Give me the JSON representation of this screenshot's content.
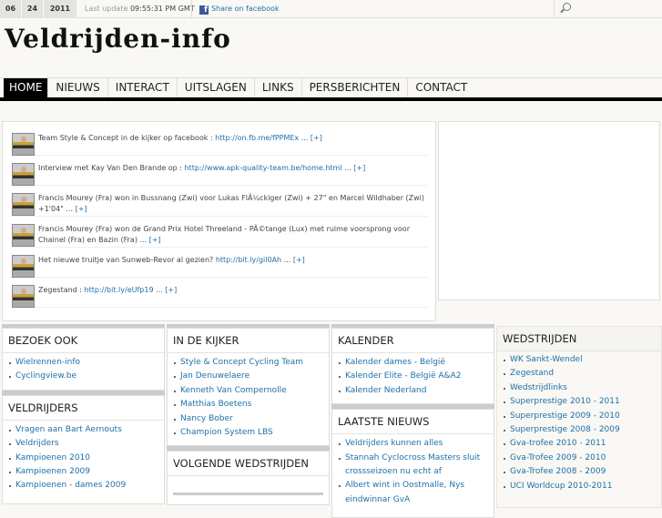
{
  "topbar": {
    "date": {
      "month": "06",
      "day": "24",
      "year": "2011"
    },
    "last_update_label": "Last update",
    "last_update_time": "09:55:31 PM GMT",
    "facebook": "Share on facebook"
  },
  "site_title": "Veldrijden-info",
  "nav": [
    "HOME",
    "NIEUWS",
    "INTERACT",
    "UITSLAGEN",
    "LINKS",
    "PERSBERICHTEN",
    "CONTACT"
  ],
  "feed": [
    {
      "text": "Team Style & Concept in de kijker op facebook :",
      "link": "http://on.fb.me/fPPMEx",
      "more": "[+]"
    },
    {
      "text": "Interview met Kay Van Den Brande op :",
      "link": "http://www.apk-quality-team.be/home.html",
      "more": "[+]"
    },
    {
      "text": "Francis Mourey (Fra) won in Bussnang (Zwi) voor Lukas FlÃ¼ckiger (Zwi) + 27\" en Marcel Wildhaber (Zwi) +1'04\"",
      "link": "",
      "more": "[+]"
    },
    {
      "text": "Francis Mourey (Fra) won de Grand Prix Hotel Threeland - PÃ©tange (Lux) met ruime voorsprong voor Chainel (Fra) en Bazin (Fra)",
      "link": "",
      "more": "[+]"
    },
    {
      "text": "Het nieuwe truitje van Sunweb-Revor al gezien?",
      "link": "http://bit.ly/gil0Ah",
      "more": "[+]"
    },
    {
      "text": "Zegestand :",
      "link": "http://bit.ly/eUfp19",
      "more": "[+]"
    }
  ],
  "bezoek": {
    "title": "BEZOEK OOK",
    "items": [
      "Wielrennen-info",
      "Cyclingview.be"
    ]
  },
  "veldrijders": {
    "title": "VELDRIJDERS",
    "items": [
      "Vragen aan Bart Aernouts",
      "Veldrijders",
      "Kampioenen 2010",
      "Kampioenen 2009",
      "Kampioenen - dames 2009"
    ]
  },
  "kijker": {
    "title": "IN DE KIJKER",
    "items": [
      "Style & Concept Cycling Team",
      "Jan Denuwelaere",
      "Kenneth Van Compernolle",
      "Matthias Boetens",
      "Nancy Bober",
      "Champion System LBS"
    ]
  },
  "volgende": {
    "title": "VOLGENDE WEDSTRIJDEN"
  },
  "kalender": {
    "title": "KALENDER",
    "items": [
      "Kalender dames - België",
      "Kalender Elite - België A&A2",
      "Kalender Nederland"
    ]
  },
  "nieuws": {
    "title": "LAATSTE NIEUWS",
    "items": [
      "Veldrijders kunnen alles",
      "Stannah Cyclocross Masters sluit crossseizoen nu echt af",
      "Albert wint in Oostmalle, Nys eindwinnar GvA"
    ]
  },
  "wedstrijden": {
    "title": "WEDSTRIJDEN",
    "items": [
      "WK Sankt-Wendel",
      "Zegestand",
      "Wedstrijdlinks",
      "Superprestige 2010 - 2011",
      "Superprestige 2009 - 2010",
      "Superprestige 2008 - 2009",
      "Gva-trofee 2010 - 2011",
      "Gva-Trofee 2009 - 2010",
      "Gva-Trofee 2008 - 2009",
      "UCI Worldcup 2010-2011"
    ]
  }
}
